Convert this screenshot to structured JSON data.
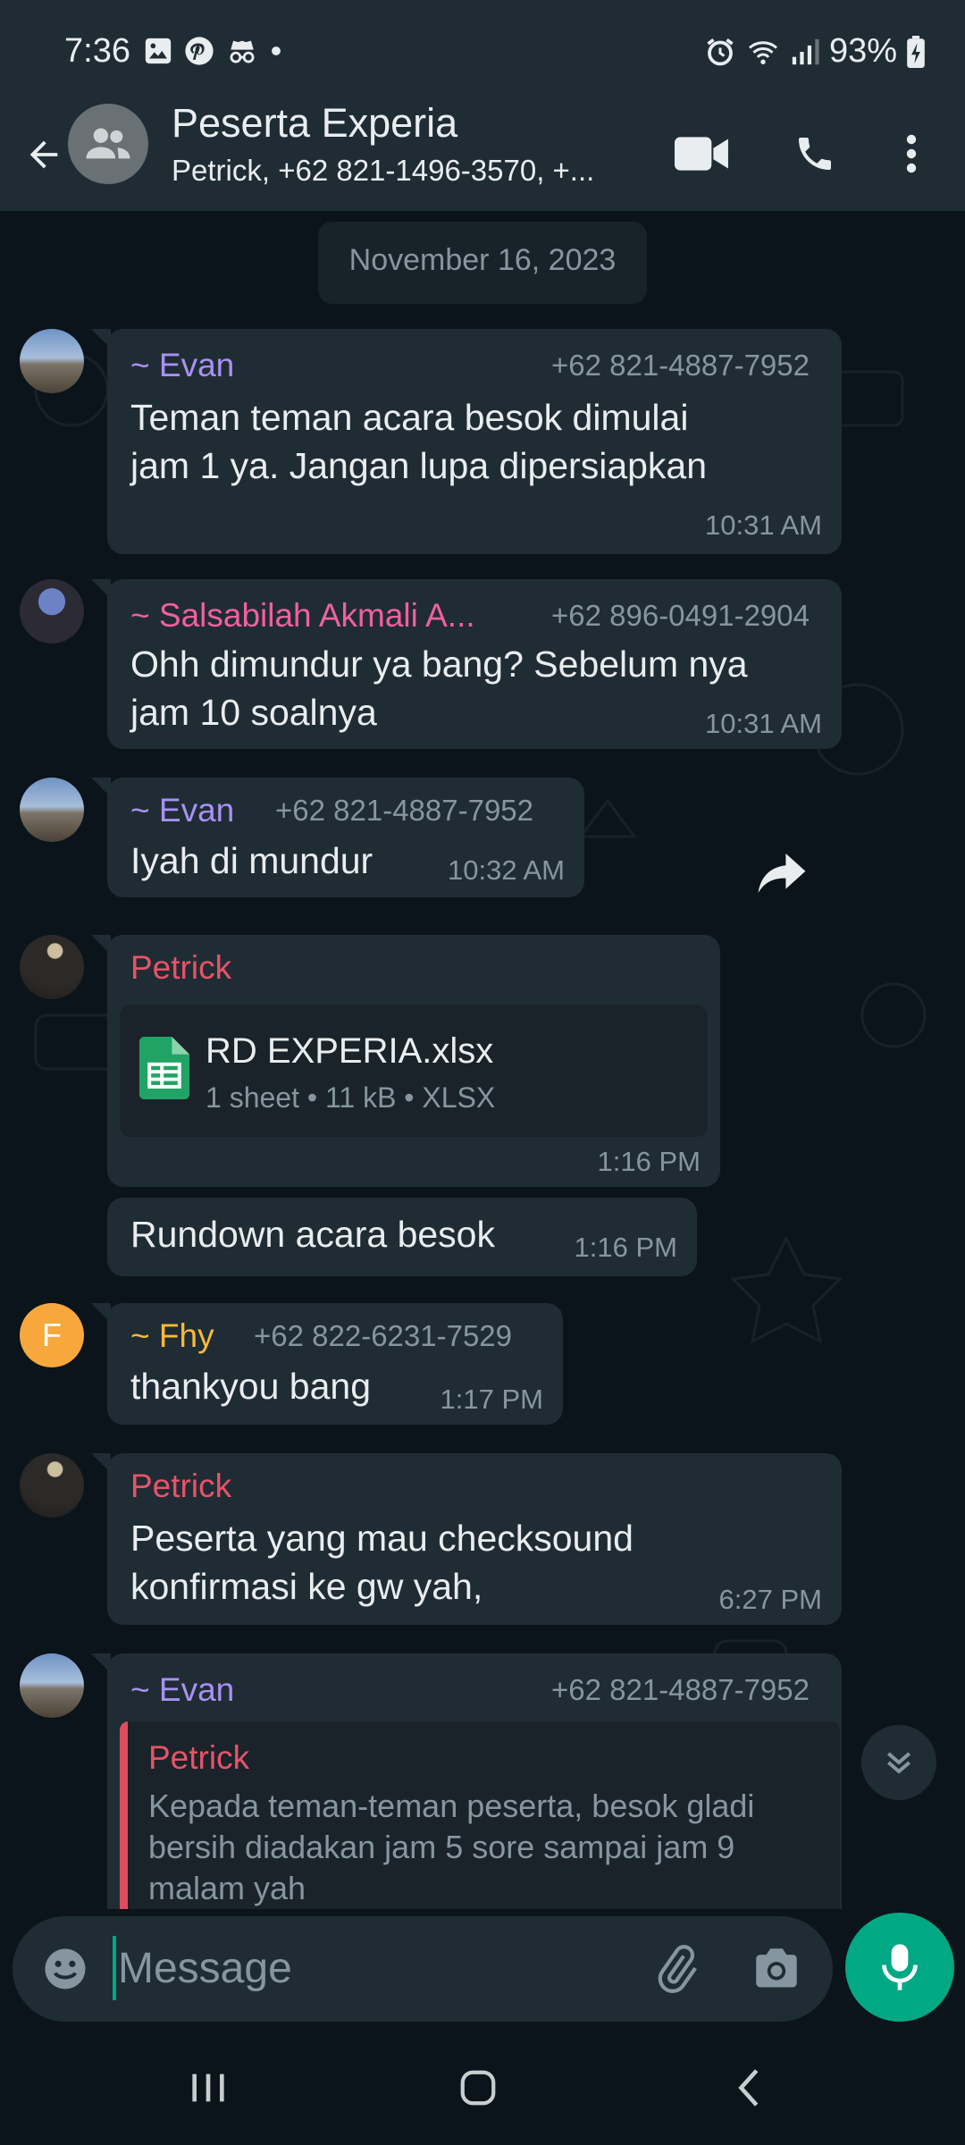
{
  "status_bar": {
    "time": "7:36",
    "battery": "93%",
    "icons": [
      "gallery-icon",
      "pinterest-icon",
      "incognito-icon",
      "dot-icon",
      "alarm-icon",
      "wifi-icon",
      "signal-icon",
      "battery-charging-icon"
    ]
  },
  "header": {
    "title": "Peserta Experia",
    "subtitle": "Petrick, +62 821-1496-3570, +...",
    "icons": [
      "back-arrow-icon",
      "group-icon",
      "video-call-icon",
      "voice-call-icon",
      "more-vert-icon"
    ]
  },
  "chat": {
    "date_chip": "November 16, 2023",
    "messages": [
      {
        "sender": "~ Evan",
        "phone": "+62 821-4887-7952",
        "lines": [
          "Teman teman acara besok dimulai",
          "jam 1 ya. Jangan lupa dipersiapkan"
        ],
        "time": "10:31 AM"
      },
      {
        "sender": "~ Salsabilah Akmali A...",
        "phone": "+62 896-0491-2904",
        "lines": [
          "Ohh dimundur ya bang? Sebelum nya",
          "jam 10 soalnya"
        ],
        "time": "10:31 AM"
      },
      {
        "sender": "~ Evan",
        "phone": "+62 821-4887-7952",
        "lines": [
          "Iyah di mundur"
        ],
        "time": "10:32 AM"
      },
      {
        "sender": "Petrick",
        "file": {
          "name": "RD EXPERIA.xlsx",
          "meta": "1 sheet • 11 kB • XLSX"
        },
        "time": "1:16 PM"
      },
      {
        "lines": [
          "Rundown acara besok"
        ],
        "time": "1:16 PM"
      },
      {
        "sender": "~ Fhy",
        "phone": "+62 822-6231-7529",
        "avatar_letter": "F",
        "lines": [
          "thankyou bang"
        ],
        "time": "1:17 PM"
      },
      {
        "sender": "Petrick",
        "lines": [
          "Peserta yang mau checksound",
          "konfirmasi ke gw yah,"
        ],
        "time": "6:27 PM"
      },
      {
        "sender": "~ Evan",
        "phone": "+62 821-4887-7952",
        "quote": {
          "sender": "Petrick",
          "lines": [
            "Kepada teman-teman peserta, besok gladi",
            "bersih diadakan jam 5 sore sampai jam 9",
            "malam yah"
          ]
        }
      }
    ]
  },
  "composer": {
    "placeholder": "Message"
  },
  "colors": {
    "background": "#0b141a",
    "bar": "#1f2c34",
    "bubble": "#202c33",
    "accent": "#00a884",
    "evan": "#a891f5",
    "salsabilah": "#f0609f",
    "petrick": "#e7536a",
    "fhy": "#f7b93d",
    "muted_text": "#8696a0"
  }
}
